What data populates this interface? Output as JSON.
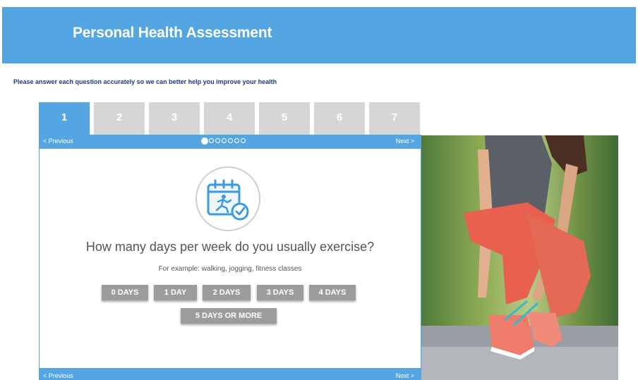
{
  "header": {
    "title": "Personal Health Assessment"
  },
  "subtitle": "Please answer each question accurately so we can better help you improve your health",
  "tabs": [
    {
      "label": "1"
    },
    {
      "label": "2"
    },
    {
      "label": "3"
    },
    {
      "label": "4"
    },
    {
      "label": "5"
    },
    {
      "label": "6"
    },
    {
      "label": "7"
    }
  ],
  "active_tab": 1,
  "nav": {
    "previous_label": "< Previous",
    "next_label": "Next >"
  },
  "progress": {
    "current_step": 1,
    "total_steps": 7
  },
  "question": {
    "icon": "calendar-exercise-icon",
    "text": "How many days per week do you usually exercise?",
    "example": "For example: walking, jogging, fitness classes",
    "options": [
      {
        "label": "0 DAYS"
      },
      {
        "label": "1 DAY"
      },
      {
        "label": "2 DAYS"
      },
      {
        "label": "3 DAYS"
      },
      {
        "label": "4 DAYS"
      },
      {
        "label": "5 DAYS OR MORE"
      }
    ]
  },
  "colors": {
    "accent": "#54a6e3",
    "tab_inactive": "#d6d6d6",
    "option_button": "#9c9c9c"
  }
}
